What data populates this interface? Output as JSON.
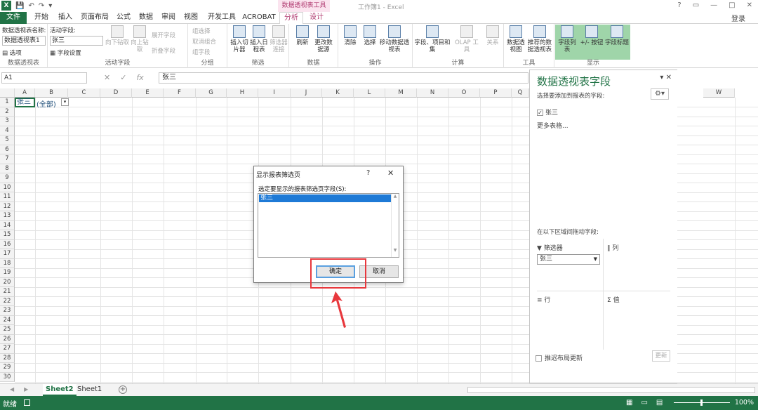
{
  "window": {
    "title": "工作簿1 - Excel",
    "context_band": "数据透视表工具",
    "login": "登录",
    "controls": [
      "?",
      "▭",
      "—",
      "□",
      "✕"
    ]
  },
  "tabs": [
    "文件",
    "开始",
    "插入",
    "页面布局",
    "公式",
    "数据",
    "审阅",
    "视图",
    "开发工具",
    "ACROBAT",
    "分析",
    "设计"
  ],
  "active_tab": "分析",
  "ribbon": {
    "pt_group": {
      "name_label": "数据透视表名称:",
      "name_value": "数据透视表1",
      "options": "选项",
      "label": "数据透视表"
    },
    "af_group": {
      "field_label": "活动字段:",
      "field_value": "张三",
      "field_settings": "字段设置",
      "drill_down": "向下钻取",
      "drill_up": "向上钻取",
      "expand": "展开字段",
      "collapse": "折叠字段",
      "label": "活动字段"
    },
    "group_group": {
      "group_sel": "组选择",
      "ungroup": "取消组合",
      "group_field": "组字段",
      "label": "分组"
    },
    "filter_group": {
      "slicer": "插入切片器",
      "timeline": "插入日程表",
      "conn": "筛选器连接",
      "label": "筛选"
    },
    "data_group": {
      "refresh": "刷新",
      "change_src": "更改数据源",
      "label": "数据"
    },
    "action_group": {
      "clear": "清除",
      "select": "选择",
      "move": "移动数据透视表",
      "label": "操作"
    },
    "calc_group": {
      "fields_items": "字段、项目和集",
      "olap": "OLAP 工具",
      "relations": "关系",
      "label": "计算"
    },
    "tools_group": {
      "pivotchart": "数据透视图",
      "recommended": "推荐的数据透视表",
      "label": "工具"
    },
    "show_group": {
      "field_list": "字段列表",
      "buttons": "+/- 按钮",
      "headers": "字段标题",
      "label": "显示"
    }
  },
  "formula_bar": {
    "namebox": "A1",
    "formula": "张三"
  },
  "columns": [
    "A",
    "B",
    "C",
    "D",
    "E",
    "F",
    "G",
    "H",
    "I",
    "J",
    "K",
    "L",
    "M",
    "N",
    "O",
    "P",
    "Q",
    "V",
    "W"
  ],
  "rows": [
    "1",
    "2",
    "3",
    "4",
    "5",
    "6",
    "7",
    "8",
    "9",
    "10",
    "11",
    "12",
    "13",
    "14",
    "15",
    "16",
    "17",
    "18",
    "19",
    "20",
    "21",
    "22",
    "23",
    "24",
    "25",
    "26",
    "27",
    "28",
    "29",
    "30"
  ],
  "cells": {
    "A1": "张三",
    "B1": "(全部)"
  },
  "pivot_pane": {
    "title": "数据透视表字段",
    "subtitle": "选择要添加到报表的字段:",
    "field": "张三",
    "more_tables": "更多表格...",
    "drag_label": "在以下区域间拖动字段:",
    "filters": "筛选器",
    "filter_value": "张三",
    "columns": "列",
    "rows": "行",
    "values": "值",
    "defer": "推迟布局更新",
    "update": "更新"
  },
  "dialog": {
    "title": "显示报表筛选页",
    "help": "?",
    "prompt": "选定要显示的报表筛选页字段(S):",
    "item": "张三",
    "ok": "确定",
    "cancel": "取消"
  },
  "sheets": [
    "Sheet2",
    "Sheet1"
  ],
  "active_sheet": "Sheet2",
  "status": {
    "ready": "就绪",
    "zoom": "100%"
  }
}
